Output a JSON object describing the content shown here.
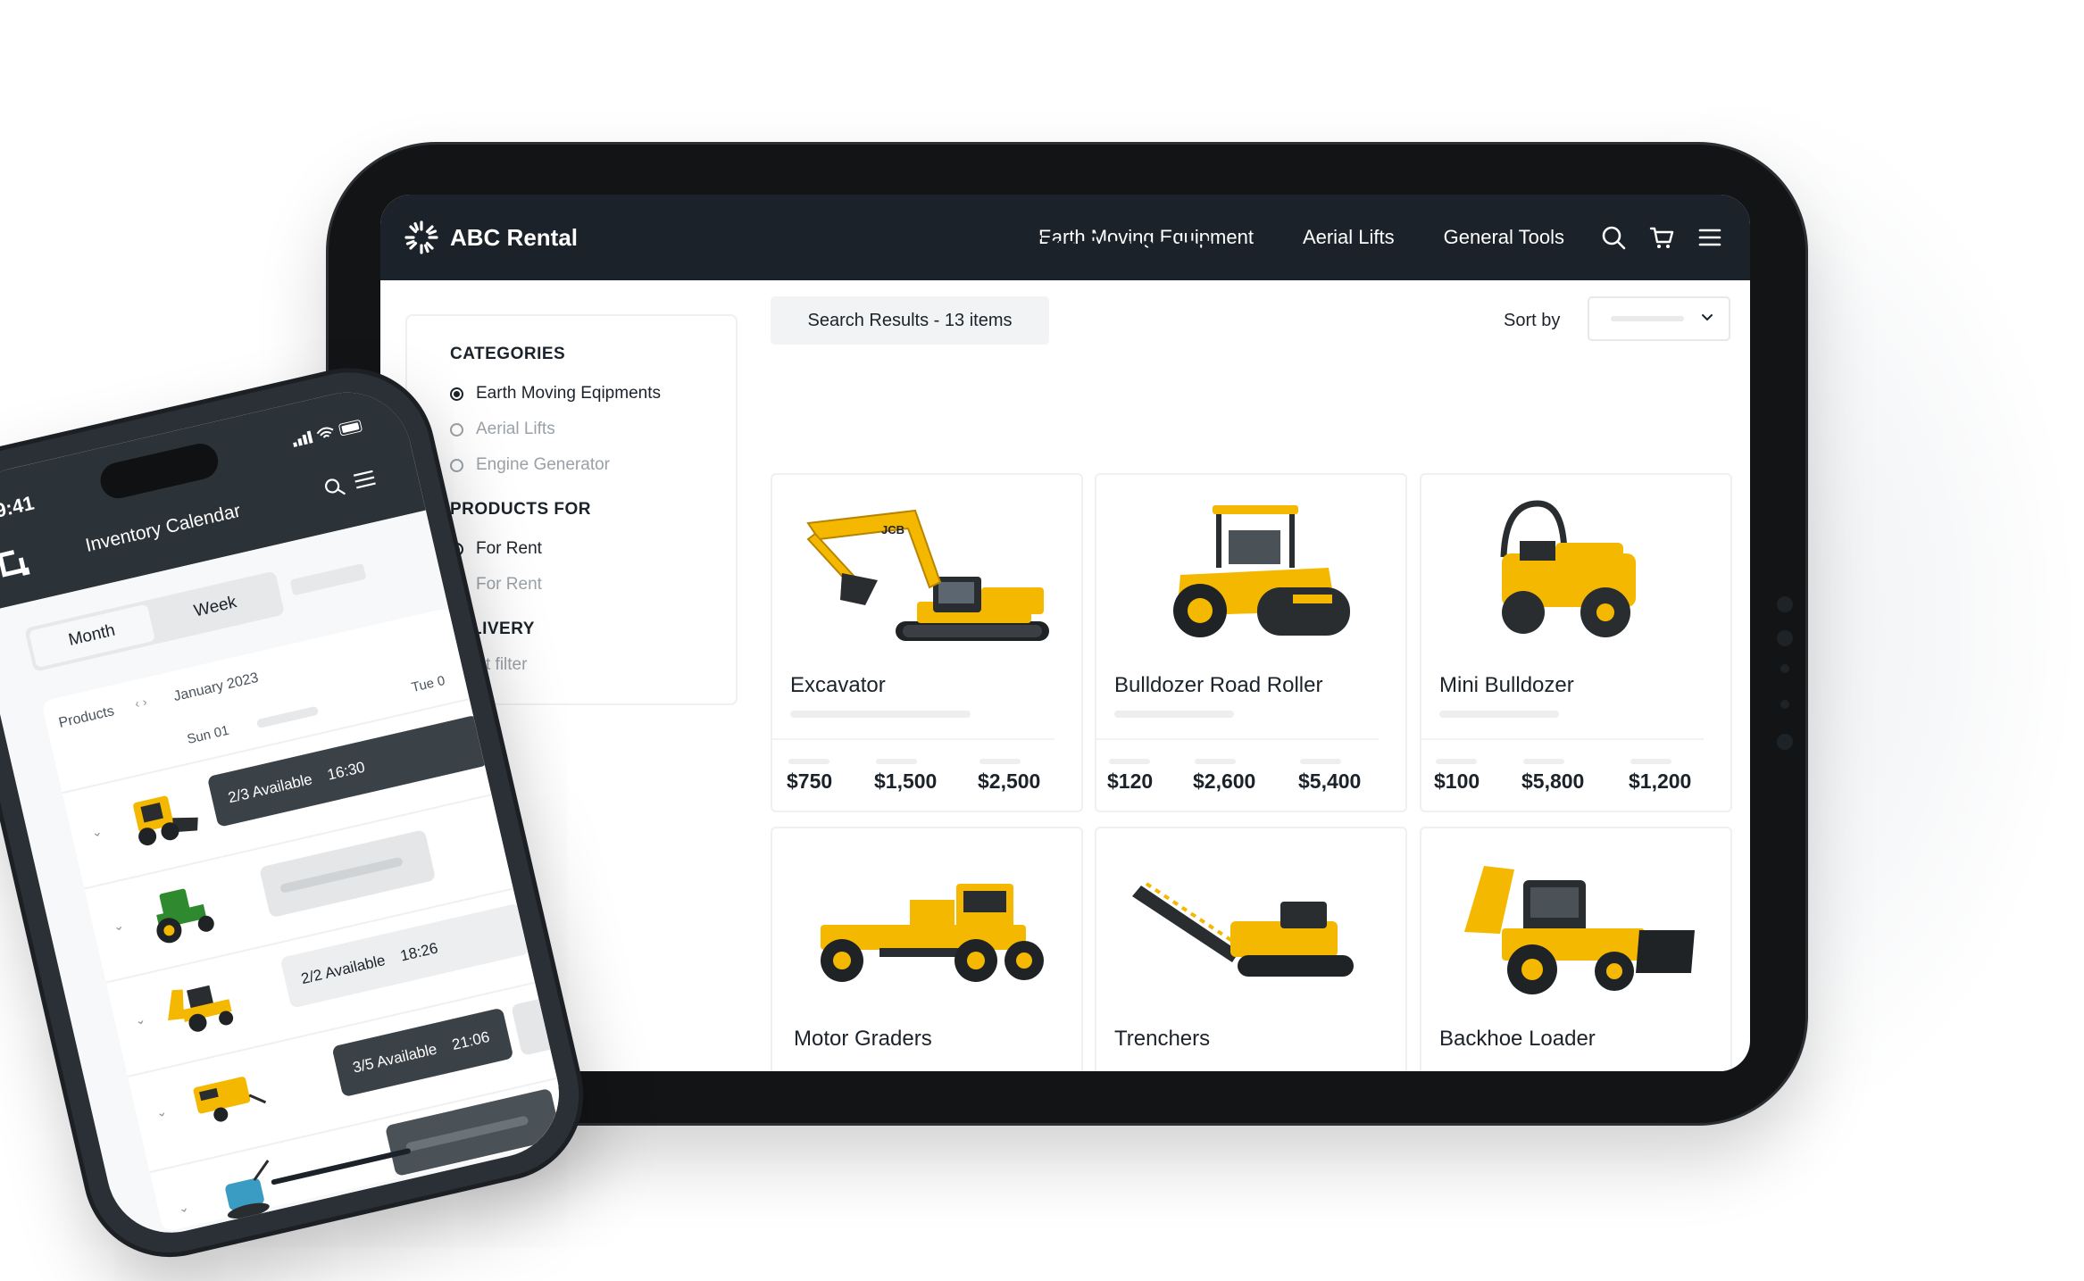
{
  "tablet": {
    "brand": {
      "name": "ABC Rental"
    },
    "nav": {
      "items": [
        "Earth Moving Equipment",
        "Aerial Lifts",
        "General Tools"
      ],
      "icons": [
        "search-icon",
        "cart-icon",
        "menu-icon"
      ]
    },
    "sidebar": {
      "categories_heading": "CATEGORIES",
      "categories": [
        {
          "label": "Earth Moving Eqipments",
          "selected": true
        },
        {
          "label": "Aerial Lifts",
          "selected": false
        },
        {
          "label": "Engine Generator",
          "selected": false
        }
      ],
      "products_heading": "PRODUCTS FOR",
      "products": [
        {
          "label": "For Rent",
          "selected": true
        },
        {
          "label": "For Rent",
          "selected": false
        }
      ],
      "delivery_heading": "LIVERY",
      "delivery_text": "t filter"
    },
    "main": {
      "title": "Earth Moving Equipment",
      "results": "Search Results - 13 items",
      "sort_label": "Sort by"
    },
    "products": [
      {
        "name": "Excavator",
        "prices": [
          "$750",
          "$1,500",
          "$2,500"
        ]
      },
      {
        "name": "Bulldozer Road Roller",
        "prices": [
          "$120",
          "$2,600",
          "$5,400"
        ]
      },
      {
        "name": "Mini Bulldozer",
        "prices": [
          "$100",
          "$5,800",
          "$1,200"
        ]
      },
      {
        "name": "Motor Graders",
        "prices": []
      },
      {
        "name": "Trenchers",
        "prices": []
      },
      {
        "name": "Backhoe Loader",
        "prices": []
      }
    ],
    "colors": {
      "accent": "#f5b800",
      "dark": "#1b222a"
    }
  },
  "phone": {
    "time": "9:41",
    "title": "Inventory Calendar",
    "tabs": {
      "month": "Month",
      "week": "Week"
    },
    "grid": {
      "col_header": "Products",
      "month": "January 2023",
      "day1": "Sun 01",
      "day2": "Tue 0"
    },
    "rows": [
      {
        "availability": "2/3 Available",
        "time": "16:30"
      },
      {
        "availability": "",
        "time": ""
      },
      {
        "availability": "2/2 Available",
        "time": "18:26"
      },
      {
        "availability": "3/5 Available",
        "time": "21:06"
      },
      {
        "availability": "",
        "time": ""
      }
    ]
  }
}
